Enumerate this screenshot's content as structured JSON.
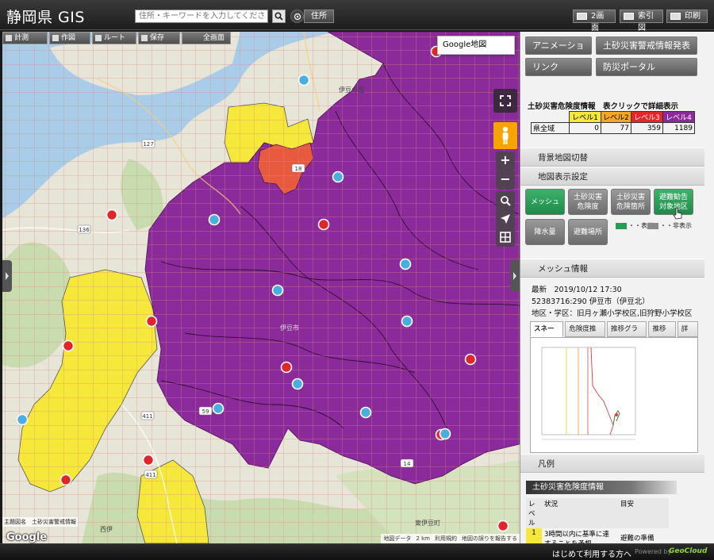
{
  "header": {
    "title": "静岡県 GIS",
    "search_placeholder": "住所・キーワードを入力してください",
    "address_label": "住所",
    "dual_screen_label": "2画面",
    "index_map_label": "索引図",
    "print_label": "印刷"
  },
  "map": {
    "toolbar": {
      "measure": "計測",
      "draw": "作図",
      "route": "ルート",
      "save": "保存",
      "fullview": "全画面"
    },
    "basemap_button": "Google地図",
    "zoom_in": "+",
    "zoom_out": "−",
    "labels": {
      "izu_kuni": "伊豆の国",
      "izu_city": "伊豆市",
      "nishi_izu": "西伊",
      "higashi_izu": "東伊豆町"
    },
    "road_numbers": [
      "127",
      "136",
      "411",
      "18",
      "59",
      "411",
      "14"
    ],
    "footer": {
      "layer_names": "主題図名　土砂災害警戒情報",
      "google": "Google",
      "map_data": "地図データ",
      "scale": "2 km",
      "terms": "利用規約",
      "report": "地図の誤りを報告する"
    }
  },
  "panel": {
    "buttons": {
      "animation": "アニメーション",
      "warning_text": "土砂災害警戒情報発表文",
      "link": "リンク",
      "portal": "防災ポータル"
    },
    "risk": {
      "heading": "土砂災害危険度情報　表クリックで詳細表示",
      "levels": [
        "レベル1",
        "レベル2",
        "レベル3",
        "レベル4"
      ],
      "level_colors": [
        "#f5e83a",
        "#f5a623",
        "#e8262a",
        "#8b2a9a"
      ],
      "row_label": "県全域",
      "values": [
        "0",
        "77",
        "359",
        "1189"
      ]
    },
    "basemap_section": "背景地図切替",
    "display_section": "地図表示設定",
    "layers": {
      "mesh": "メッシュ",
      "danger_degree": [
        "土砂災害",
        "危険度"
      ],
      "danger_spots": [
        "土砂災害",
        "危険箇所"
      ],
      "evacuation_areas": [
        "避難勧告",
        "対象地区"
      ],
      "rainfall": "降水量",
      "shelters": "避難場所",
      "legend_show": "・・表示",
      "legend_hide": "・・非表示"
    },
    "mesh_info": {
      "section": "メッシュ情報",
      "latest": "最新　2019/10/12 17:30",
      "mesh_id": "52383716:290 伊豆市（伊豆北）",
      "district": "地区・学区：旧月ヶ瀬小学校区,旧狩野小学校区",
      "tabs": [
        "スネーク",
        "危険度推移",
        "推移グラフ",
        "推移表",
        "詳細"
      ]
    },
    "legend": {
      "section": "凡例",
      "title": "土砂災害危険度情報",
      "col_level": "レベル",
      "col_status": "状況",
      "col_guide": "目安",
      "row1_level": "1",
      "row1_status": "3時間以内に基準に達することを予想",
      "row1_guide": "避難の準備"
    }
  },
  "statusbar": {
    "first_time": "はじめて利用する方へ",
    "powered_by": "Powered by",
    "company": "GeoCloud"
  },
  "colors": {
    "level4": "#8b2a9a",
    "level1": "#f5e83a",
    "level3": "#e8262a",
    "mesh_on": "#2a9a55"
  }
}
